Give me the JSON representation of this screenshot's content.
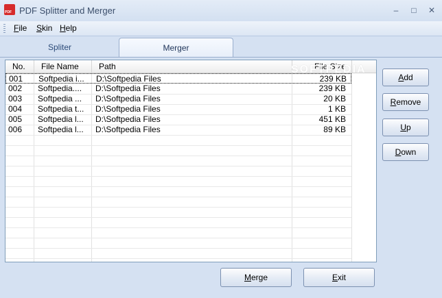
{
  "window": {
    "title": "PDF Splitter and Merger",
    "icon_label": "PDF",
    "minimize": "–",
    "maximize": "□",
    "close": "✕"
  },
  "menu": [
    {
      "first": "F",
      "rest": "ile"
    },
    {
      "first": "S",
      "rest": "kin"
    },
    {
      "first": "H",
      "rest": "elp"
    }
  ],
  "tabs": {
    "spliter": "Spliter",
    "merger": "Merger"
  },
  "table": {
    "columns": {
      "no": "No.",
      "file_name": "File Name",
      "path": "Path",
      "file_size": "File Size"
    },
    "rows": [
      {
        "no": "001",
        "file_name": "Softpedia i...",
        "path": "D:\\Softpedia Files",
        "file_size": "239 KB"
      },
      {
        "no": "002",
        "file_name": "Softpedia....",
        "path": "D:\\Softpedia Files",
        "file_size": "239 KB"
      },
      {
        "no": "003",
        "file_name": "Softpedia ...",
        "path": "D:\\Softpedia Files",
        "file_size": "20 KB"
      },
      {
        "no": "004",
        "file_name": "Softpedia t...",
        "path": "D:\\Softpedia Files",
        "file_size": "1 KB"
      },
      {
        "no": "005",
        "file_name": "Softpedia l...",
        "path": "D:\\Softpedia Files",
        "file_size": "451 KB"
      },
      {
        "no": "006",
        "file_name": "Softpedia l...",
        "path": "D:\\Softpedia Files",
        "file_size": "89 KB"
      }
    ]
  },
  "watermark": "SOFTPEDIA",
  "side_buttons": {
    "add": {
      "first": "A",
      "rest": "dd"
    },
    "remove": {
      "first": "R",
      "rest": "emove"
    },
    "up": {
      "first": "U",
      "rest": "p"
    },
    "down": {
      "first": "D",
      "rest": "own"
    }
  },
  "bottom_buttons": {
    "merge": {
      "first": "M",
      "rest": "erge"
    },
    "exit": {
      "first": "E",
      "rest": "xit"
    }
  },
  "colors": {
    "window_bg": "#d5e1f2",
    "title_text": "#3b4e6b",
    "tab_text": "#2b4a78"
  }
}
